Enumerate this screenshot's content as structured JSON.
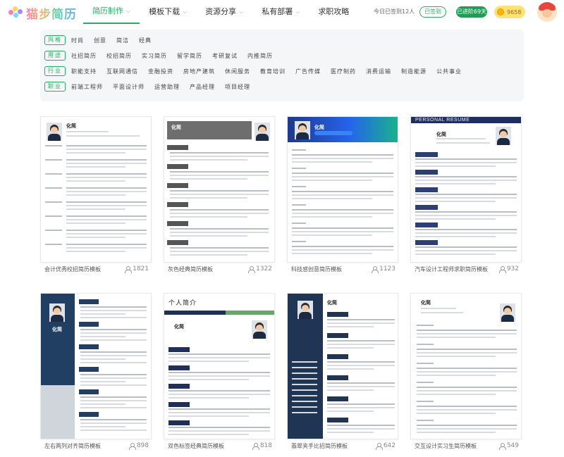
{
  "logo": {
    "text": "猫步简历"
  },
  "nav": {
    "items": [
      {
        "label": "简历制作",
        "has_dropdown": true,
        "active": true
      },
      {
        "label": "模板下载",
        "has_dropdown": true
      },
      {
        "label": "资源分享",
        "has_dropdown": true
      },
      {
        "label": "私有部署",
        "has_dropdown": true
      },
      {
        "label": "求职攻略",
        "has_dropdown": false
      }
    ],
    "signin_text": "今日已签到12人",
    "signed_label": "已签到",
    "vip_label": "已进阶69天",
    "coin_value": "9658"
  },
  "filters": {
    "rows": [
      {
        "tag": "风格",
        "options": [
          "时尚",
          "创意",
          "简洁",
          "经典"
        ]
      },
      {
        "tag": "用途",
        "options": [
          "社招简历",
          "校招简历",
          "实习简历",
          "留学简历",
          "考研复试",
          "内推简历"
        ]
      },
      {
        "tag": "行业",
        "options": [
          "职能支持",
          "互联网通信",
          "金融投资",
          "房地产建筑",
          "休闲服务",
          "教育培训",
          "广告传媒",
          "医疗制药",
          "消费运输",
          "制造能源",
          "公共事业"
        ]
      },
      {
        "tag": "职业",
        "options": [
          "前端工程师",
          "平面设计师",
          "运营助理",
          "产品经理",
          "项目经理"
        ]
      }
    ]
  },
  "templates": [
    {
      "caption": "会计优秀校招简历模板",
      "count": "1821",
      "name": "化简"
    },
    {
      "caption": "灰色经典简历模板",
      "count": "1322",
      "name": "化简"
    },
    {
      "caption": "科技感创意简历模板",
      "count": "1123",
      "name": "化简"
    },
    {
      "caption": "汽车设计工程师求职简历模板",
      "count": "932",
      "name": "化简",
      "banner": "PERSONAL RESUME"
    },
    {
      "caption": "左右两列对齐简历模板",
      "count": "898",
      "name": "化简"
    },
    {
      "caption": "双色标签经典简历模板",
      "count": "818",
      "name": "化简",
      "banner": "个人简介"
    },
    {
      "caption": "翡翠夹手比招简历模板",
      "count": "642",
      "name": "化简"
    },
    {
      "caption": "交互设计实习生简历模板",
      "count": "549",
      "name": "化简"
    }
  ],
  "colors": {
    "accent": "#27ae60",
    "vip": "#1f9d55",
    "coin": "#ffe17a"
  }
}
